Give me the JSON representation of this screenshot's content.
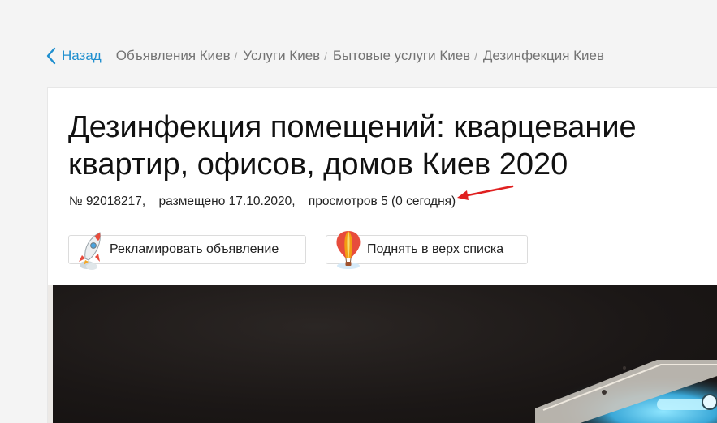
{
  "breadcrumbs": {
    "back_label": "Назад",
    "items": [
      "Объявления Киев",
      "Услуги Киев",
      "Бытовые услуги Киев",
      "Дезинфекция Киев"
    ],
    "separator": "/"
  },
  "listing": {
    "title": "Дезинфекция помещений: кварцевание квартир, офисов, домов Киев 2020",
    "id_text": "№ 92018217,",
    "posted_text": "размещено 17.10.2020,",
    "views_text": "просмотров 5 (0 сегодня)"
  },
  "actions": {
    "advertise_label": "Рекламировать объявление",
    "raise_label": "Поднять в верх списка"
  },
  "colors": {
    "link": "#1f8fcf",
    "annotation_arrow": "#e02020"
  },
  "icons": {
    "back": "chevron-left-icon",
    "advertise": "rocket-icon",
    "raise": "hot-air-balloon-icon"
  }
}
